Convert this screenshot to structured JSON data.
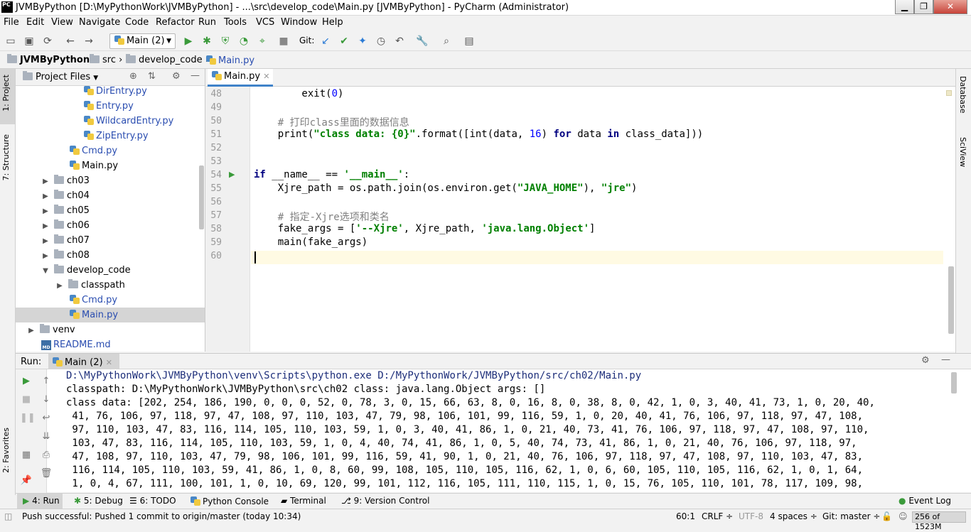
{
  "window": {
    "title": "JVMByPython [D:\\MyPythonWork\\JVMByPython] - ...\\src\\develop_code\\Main.py [JVMByPython] - PyCharm (Administrator)",
    "app_badge": "PC"
  },
  "menu": [
    "File",
    "Edit",
    "View",
    "Navigate",
    "Code",
    "Refactor",
    "Run",
    "Tools",
    "VCS",
    "Window",
    "Help"
  ],
  "toolbar": {
    "run_config": "Main (2)",
    "git_label": "Git:"
  },
  "breadcrumb": [
    "JVMByPython",
    "src",
    "develop_code",
    "Main.py"
  ],
  "left_tabs": {
    "project": "1: Project",
    "structure": "7: Structure",
    "favorites": "2: Favorites"
  },
  "right_tabs": {
    "database": "Database",
    "sciview": "SciView"
  },
  "project": {
    "header": "Project Files",
    "rows": [
      {
        "label": "DirEntry.py",
        "kind": "py",
        "indent": 5,
        "color": "blue"
      },
      {
        "label": "Entry.py",
        "kind": "py",
        "indent": 5,
        "color": "blue"
      },
      {
        "label": "WildcardEntry.py",
        "kind": "py",
        "indent": 5,
        "color": "blue"
      },
      {
        "label": "ZipEntry.py",
        "kind": "py",
        "indent": 5,
        "color": "blue"
      },
      {
        "label": "Cmd.py",
        "kind": "py",
        "indent": 4,
        "color": "blue"
      },
      {
        "label": "Main.py",
        "kind": "py",
        "indent": 4,
        "color": "plain"
      },
      {
        "label": "ch03",
        "kind": "folder",
        "indent": 2,
        "arrow": "▶"
      },
      {
        "label": "ch04",
        "kind": "folder",
        "indent": 2,
        "arrow": "▶"
      },
      {
        "label": "ch05",
        "kind": "folder",
        "indent": 2,
        "arrow": "▶"
      },
      {
        "label": "ch06",
        "kind": "folder",
        "indent": 2,
        "arrow": "▶"
      },
      {
        "label": "ch07",
        "kind": "folder",
        "indent": 2,
        "arrow": "▶"
      },
      {
        "label": "ch08",
        "kind": "folder",
        "indent": 2,
        "arrow": "▶"
      },
      {
        "label": "develop_code",
        "kind": "folder",
        "indent": 2,
        "arrow": "▼"
      },
      {
        "label": "classpath",
        "kind": "folder",
        "indent": 3,
        "arrow": "▶"
      },
      {
        "label": "Cmd.py",
        "kind": "py",
        "indent": 4,
        "color": "blue"
      },
      {
        "label": "Main.py",
        "kind": "py",
        "indent": 4,
        "color": "blue",
        "selected": true
      },
      {
        "label": "venv",
        "kind": "folder",
        "indent": 1,
        "arrow": "▶"
      },
      {
        "label": "README.md",
        "kind": "md",
        "indent": 2,
        "color": "blue"
      }
    ]
  },
  "editor": {
    "tab": "Main.py",
    "lines": [
      {
        "n": "48",
        "text": "        exit(0)"
      },
      {
        "n": "49",
        "text": ""
      },
      {
        "n": "50",
        "text": "    # 打印class里面的数据信息"
      },
      {
        "n": "51",
        "text": "    print(\"class data: {0}\".format([int(data, 16) for data in class_data]))"
      },
      {
        "n": "52",
        "text": ""
      },
      {
        "n": "53",
        "text": ""
      },
      {
        "n": "54",
        "text": "if __name__ == '__main__':"
      },
      {
        "n": "55",
        "text": "    Xjre_path = os.path.join(os.environ.get(\"JAVA_HOME\"), \"jre\")"
      },
      {
        "n": "56",
        "text": ""
      },
      {
        "n": "57",
        "text": "    # 指定-Xjre选项和类名"
      },
      {
        "n": "58",
        "text": "    fake_args = ['--Xjre', Xjre_path, 'java.lang.Object']"
      },
      {
        "n": "59",
        "text": "    main(fake_args)"
      },
      {
        "n": "60",
        "text": ""
      }
    ]
  },
  "run": {
    "label": "Run:",
    "tab": "Main (2)",
    "console": [
      "D:\\MyPythonWork\\JVMByPython\\venv\\Scripts\\python.exe D:/MyPythonWork/JVMByPython/src/ch02/Main.py",
      "classpath: D:\\MyPythonWork\\JVMByPython\\src\\ch02 class: java.lang.Object args: []",
      "class data: [202, 254, 186, 190, 0, 0, 0, 52, 0, 78, 3, 0, 15, 66, 63, 8, 0, 16, 8, 0, 38, 8, 0, 42, 1, 0, 3, 40, 41, 73, 1, 0, 20, 40,",
      " 41, 76, 106, 97, 118, 97, 47, 108, 97, 110, 103, 47, 79, 98, 106, 101, 99, 116, 59, 1, 0, 20, 40, 41, 76, 106, 97, 118, 97, 47, 108,",
      " 97, 110, 103, 47, 83, 116, 114, 105, 110, 103, 59, 1, 0, 3, 40, 41, 86, 1, 0, 21, 40, 73, 41, 76, 106, 97, 118, 97, 47, 108, 97, 110,",
      " 103, 47, 83, 116, 114, 105, 110, 103, 59, 1, 0, 4, 40, 74, 41, 86, 1, 0, 5, 40, 74, 73, 41, 86, 1, 0, 21, 40, 76, 106, 97, 118, 97,",
      " 47, 108, 97, 110, 103, 47, 79, 98, 106, 101, 99, 116, 59, 41, 90, 1, 0, 21, 40, 76, 106, 97, 118, 97, 47, 108, 97, 110, 103, 47, 83,",
      " 116, 114, 105, 110, 103, 59, 41, 86, 1, 0, 8, 60, 99, 108, 105, 110, 105, 116, 62, 1, 0, 6, 60, 105, 110, 105, 116, 62, 1, 0, 1, 64,",
      " 1, 0, 4, 67, 111, 100, 101, 1, 0, 10, 69, 120, 99, 101, 112, 116, 105, 111, 110, 115, 1, 0, 15, 76, 105, 110, 101, 78, 117, 109, 98,"
    ]
  },
  "bottom_tabs": [
    "4: Run",
    "5: Debug",
    "6: TODO",
    "Python Console",
    "Terminal",
    "9: Version Control",
    "Event Log"
  ],
  "status": {
    "message": "Push successful: Pushed 1 commit to origin/master (today 10:34)",
    "position": "60:1",
    "line_sep": "CRLF ÷",
    "encoding": "UTF-8",
    "indent": "4 spaces ÷",
    "vcs": "Git: master ÷",
    "memory": "256 of 1523M"
  },
  "colors": {
    "keyword": "#000080",
    "string": "#008000",
    "number": "#0000ff",
    "comment": "#808080",
    "current_line": "#fffae3",
    "tab_underline": "#4083c9"
  }
}
